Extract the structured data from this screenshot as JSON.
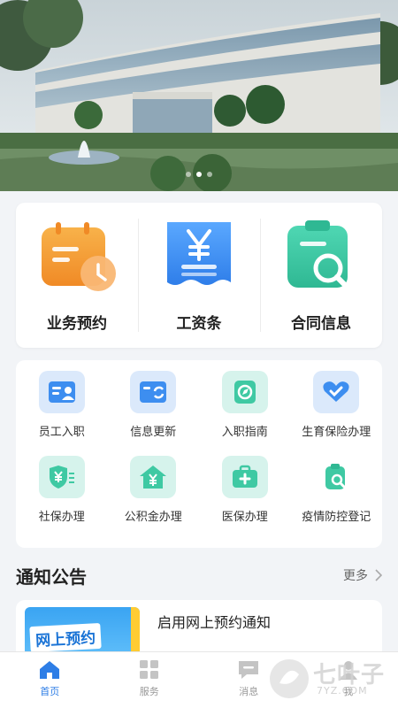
{
  "banner": {
    "slides": 3,
    "active_slide": 1
  },
  "main_services": [
    {
      "label": "业务预约",
      "icon": "calendar-clock-icon"
    },
    {
      "label": "工资条",
      "icon": "yen-receipt-icon"
    },
    {
      "label": "合同信息",
      "icon": "clipboard-search-icon"
    }
  ],
  "services": [
    {
      "label": "员工入职",
      "icon": "id-card-icon"
    },
    {
      "label": "信息更新",
      "icon": "refresh-card-icon"
    },
    {
      "label": "入职指南",
      "icon": "compass-icon"
    },
    {
      "label": "生育保险办理",
      "icon": "heart-hands-icon"
    },
    {
      "label": "社保办理",
      "icon": "shield-yen-icon"
    },
    {
      "label": "公积金办理",
      "icon": "house-yen-icon"
    },
    {
      "label": "医保办理",
      "icon": "medical-kit-icon"
    },
    {
      "label": "疫情防控登记",
      "icon": "clipboard-search-icon"
    }
  ],
  "notices": {
    "title": "通知公告",
    "more": "更多",
    "items": [
      {
        "title": "启用网上预约通知",
        "thumb_text": "网上预约"
      }
    ]
  },
  "tabbar": [
    {
      "label": "首页",
      "icon": "home-icon",
      "active": true
    },
    {
      "label": "服务",
      "icon": "grid-icon",
      "active": false
    },
    {
      "label": "消息",
      "icon": "message-icon",
      "active": false
    },
    {
      "label": "我",
      "icon": "user-icon",
      "active": false
    }
  ],
  "watermark": {
    "text": "七叶子",
    "sub": "7YZ.COM"
  },
  "colors": {
    "accent": "#2e7ee6",
    "orange": "#f5a03a",
    "blue": "#3d8ef0",
    "green": "#3fc9a3"
  }
}
